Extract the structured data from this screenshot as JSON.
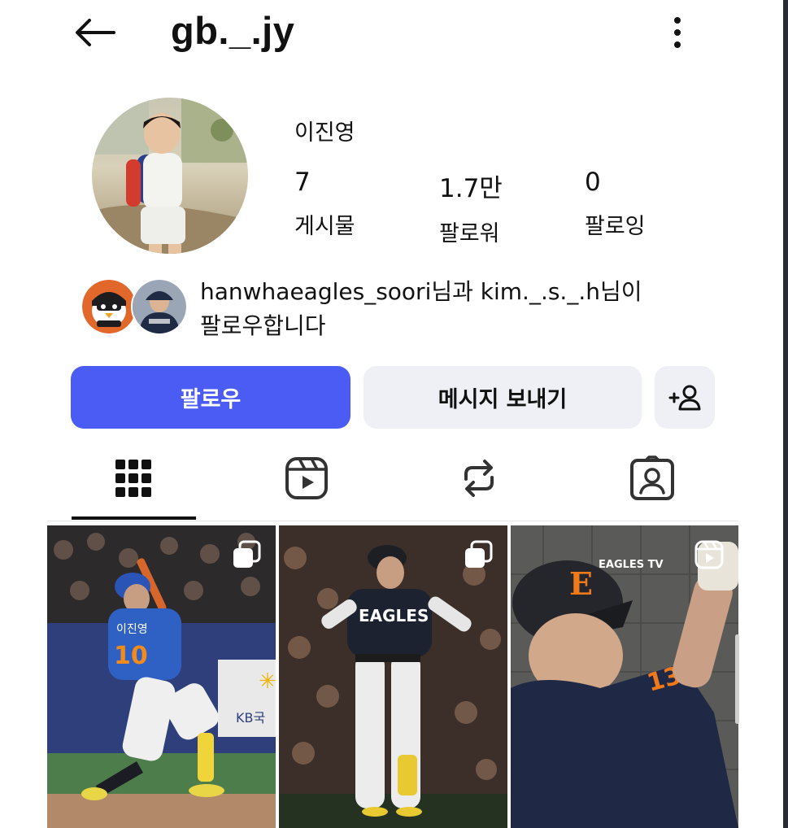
{
  "header": {
    "username": "gb._.jy",
    "back_icon": "arrow-left-icon",
    "more_icon": "more-vertical-icon"
  },
  "profile": {
    "display_name": "이진영",
    "stats": [
      {
        "value": "7",
        "label": "게시물"
      },
      {
        "value": "1.7만",
        "label": "팔로워"
      },
      {
        "value": "0",
        "label": "팔로잉"
      }
    ]
  },
  "followed_by": {
    "line1": "hanwhaeagles_soori님과 kim._.s._.h님이",
    "line2": "팔로우합니다"
  },
  "actions": {
    "follow_label": "팔로우",
    "message_label": "메시지 보내기",
    "add_person_icon": "add-person-icon"
  },
  "tabs": [
    {
      "name": "posts",
      "icon": "grid-icon",
      "active": true
    },
    {
      "name": "reels",
      "icon": "reels-icon",
      "active": false
    },
    {
      "name": "reposts",
      "icon": "repost-icon",
      "active": false
    },
    {
      "name": "tagged",
      "icon": "tagged-person-icon",
      "active": false
    }
  ],
  "posts": [
    {
      "type": "carousel",
      "badge_icon": "carousel-icon",
      "jersey_name": "이진영",
      "jersey_number": "10",
      "banner_text": "KB국"
    },
    {
      "type": "carousel",
      "badge_icon": "carousel-icon",
      "jersey_text": "EAGLES"
    },
    {
      "type": "reel",
      "badge_icon": "reel-icon",
      "watermark": "EAGLES TV",
      "jersey_number": "13"
    }
  ],
  "colors": {
    "accent": "#4b5cf4",
    "secondary_button": "#eff0f5"
  }
}
